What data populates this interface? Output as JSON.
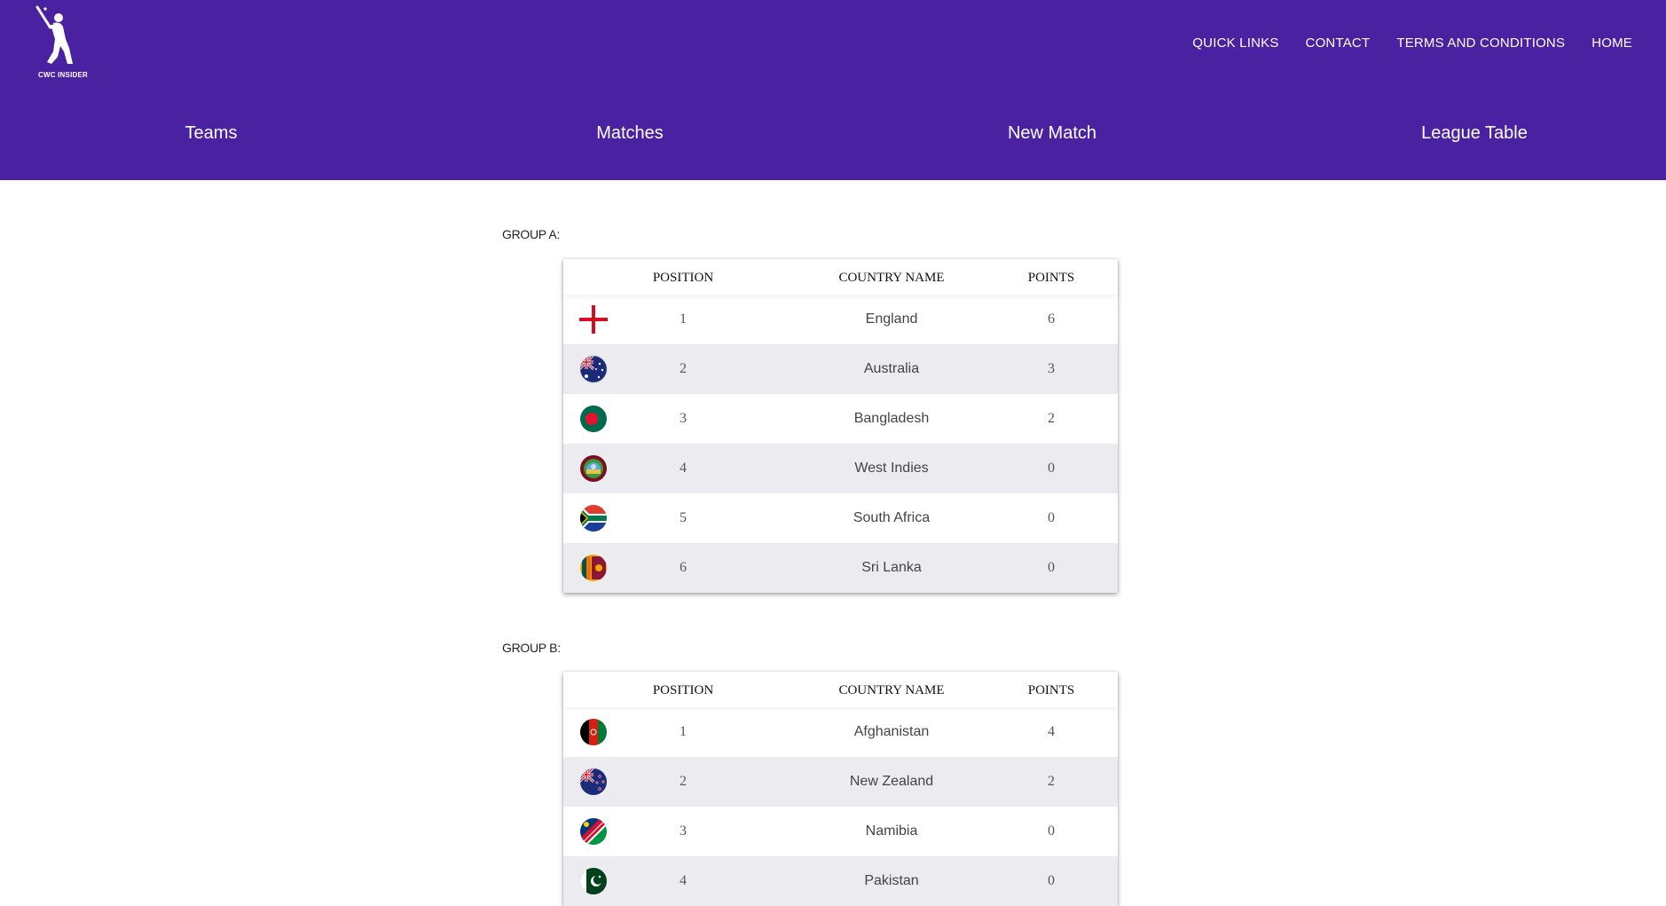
{
  "site": {
    "logo_text": "CWC INSIDER"
  },
  "top_links": [
    "QUICK LINKS",
    "CONTACT",
    "TERMS AND CONDITIONS",
    "HOME"
  ],
  "main_nav": [
    "Teams",
    "Matches",
    "New Match",
    "League Table"
  ],
  "table_headers": {
    "position": "POSITION",
    "country": "COUNTRY NAME",
    "points": "POINTS"
  },
  "groups": [
    {
      "label": "GROUP A:",
      "rows": [
        {
          "flag": "england-flag",
          "position": "1",
          "country": "England",
          "points": "6"
        },
        {
          "flag": "australia-flag",
          "position": "2",
          "country": "Australia",
          "points": "3"
        },
        {
          "flag": "bangladesh-flag",
          "position": "3",
          "country": "Bangladesh",
          "points": "2"
        },
        {
          "flag": "west-indies-flag",
          "position": "4",
          "country": "West Indies",
          "points": "0"
        },
        {
          "flag": "south-africa-flag",
          "position": "5",
          "country": "South Africa",
          "points": "0"
        },
        {
          "flag": "sri-lanka-flag",
          "position": "6",
          "country": "Sri Lanka",
          "points": "0"
        }
      ]
    },
    {
      "label": "GROUP B:",
      "rows": [
        {
          "flag": "afghanistan-flag",
          "position": "1",
          "country": "Afghanistan",
          "points": "4"
        },
        {
          "flag": "new-zealand-flag",
          "position": "2",
          "country": "New Zealand",
          "points": "2"
        },
        {
          "flag": "namibia-flag",
          "position": "3",
          "country": "Namibia",
          "points": "0"
        },
        {
          "flag": "pakistan-flag",
          "position": "4",
          "country": "Pakistan",
          "points": "0"
        }
      ]
    }
  ],
  "colors": {
    "header_bg": "#4a21a0",
    "row_alt_bg": "#ececf0",
    "text": "#444444"
  }
}
